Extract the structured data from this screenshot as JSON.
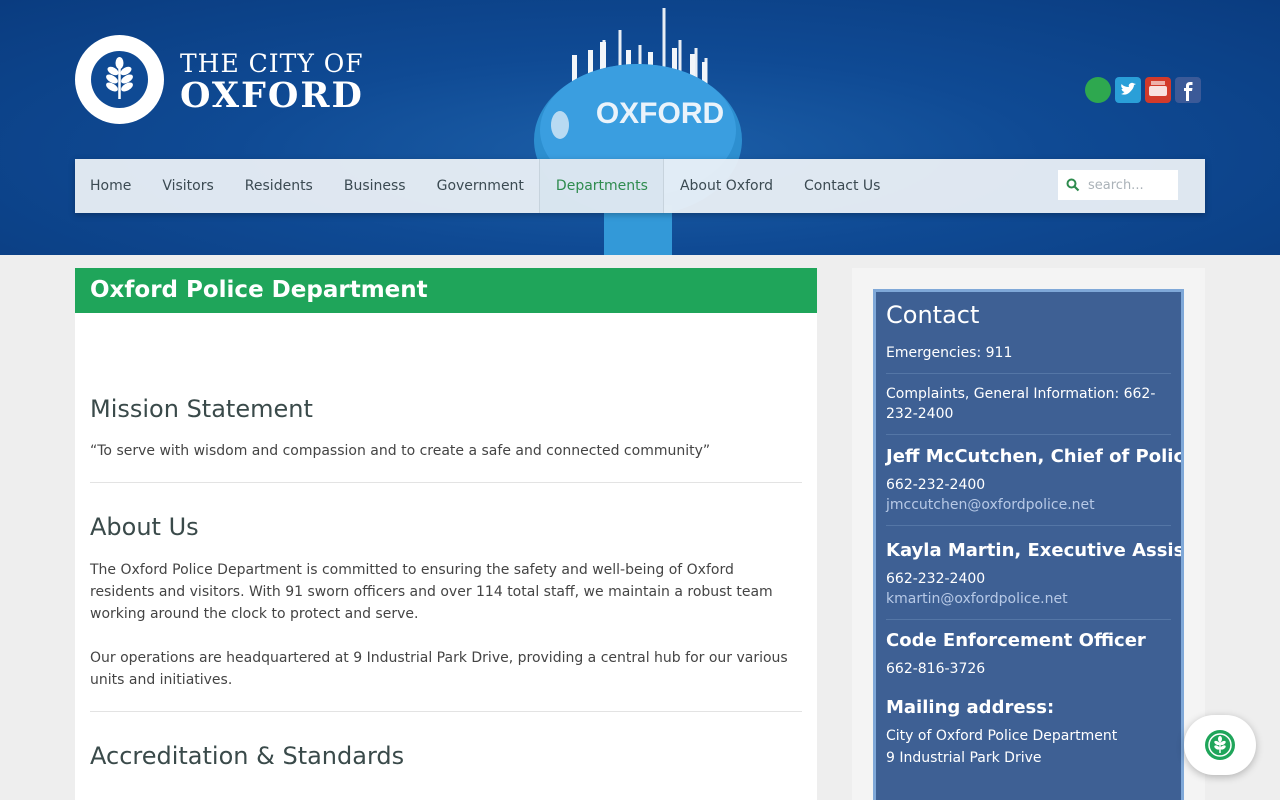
{
  "site": {
    "logo_line1": "THE CITY OF",
    "logo_line2": "OXFORD",
    "tower_text": "OXFORD"
  },
  "social": [
    {
      "icon": "globe-icon",
      "color": "#2ea84f"
    },
    {
      "icon": "twitter-icon",
      "color": "#2a9fd8"
    },
    {
      "icon": "youtube-icon",
      "color": "#d23a2a"
    },
    {
      "icon": "facebook-icon",
      "color": "#3b5a98"
    }
  ],
  "nav": {
    "items": [
      "Home",
      "Visitors",
      "Residents",
      "Business",
      "Government",
      "Departments",
      "About Oxford",
      "Contact Us"
    ],
    "active": "Departments",
    "search_placeholder": "search..."
  },
  "page": {
    "title": "Oxford Police Department",
    "mission_heading": "Mission Statement",
    "mission_text": "“To serve with wisdom and compassion and to create a safe and connected community”",
    "about_heading": "About Us",
    "about_p1": "The Oxford Police Department is committed to ensuring the safety and well-being of Oxford residents and visitors. With 91 sworn officers and over 114 total staff, we maintain a robust team working around the clock to protect and serve.",
    "about_p2": "Our operations are headquartered at 9 Industrial Park Drive, providing a central hub for our various units and initiatives.",
    "accreditation_heading": "Accreditation & Standards"
  },
  "contact": {
    "title": "Contact",
    "emergencies": "Emergencies: 911",
    "general": "Complaints, General Information: 662-232-2400",
    "people": [
      {
        "name": "Jeff McCutchen, Chief of Police",
        "phone": "662-232-2400",
        "email": "jmccutchen@oxfordpolice.net"
      },
      {
        "name": "Kayla Martin, Executive Assistant",
        "phone": "662-232-2400",
        "email": "kmartin@oxfordpolice.net"
      },
      {
        "name": "Code Enforcement Officer",
        "phone": "662-816-3726",
        "email": ""
      }
    ],
    "mailing_heading": "Mailing address:",
    "mailing_line1": "City of Oxford Police Department",
    "mailing_line2": "9 Industrial Park Drive"
  },
  "colors": {
    "header_blue": "#0f4a94",
    "title_green": "#1fa55a",
    "sidebar_blue": "#3e6094"
  }
}
